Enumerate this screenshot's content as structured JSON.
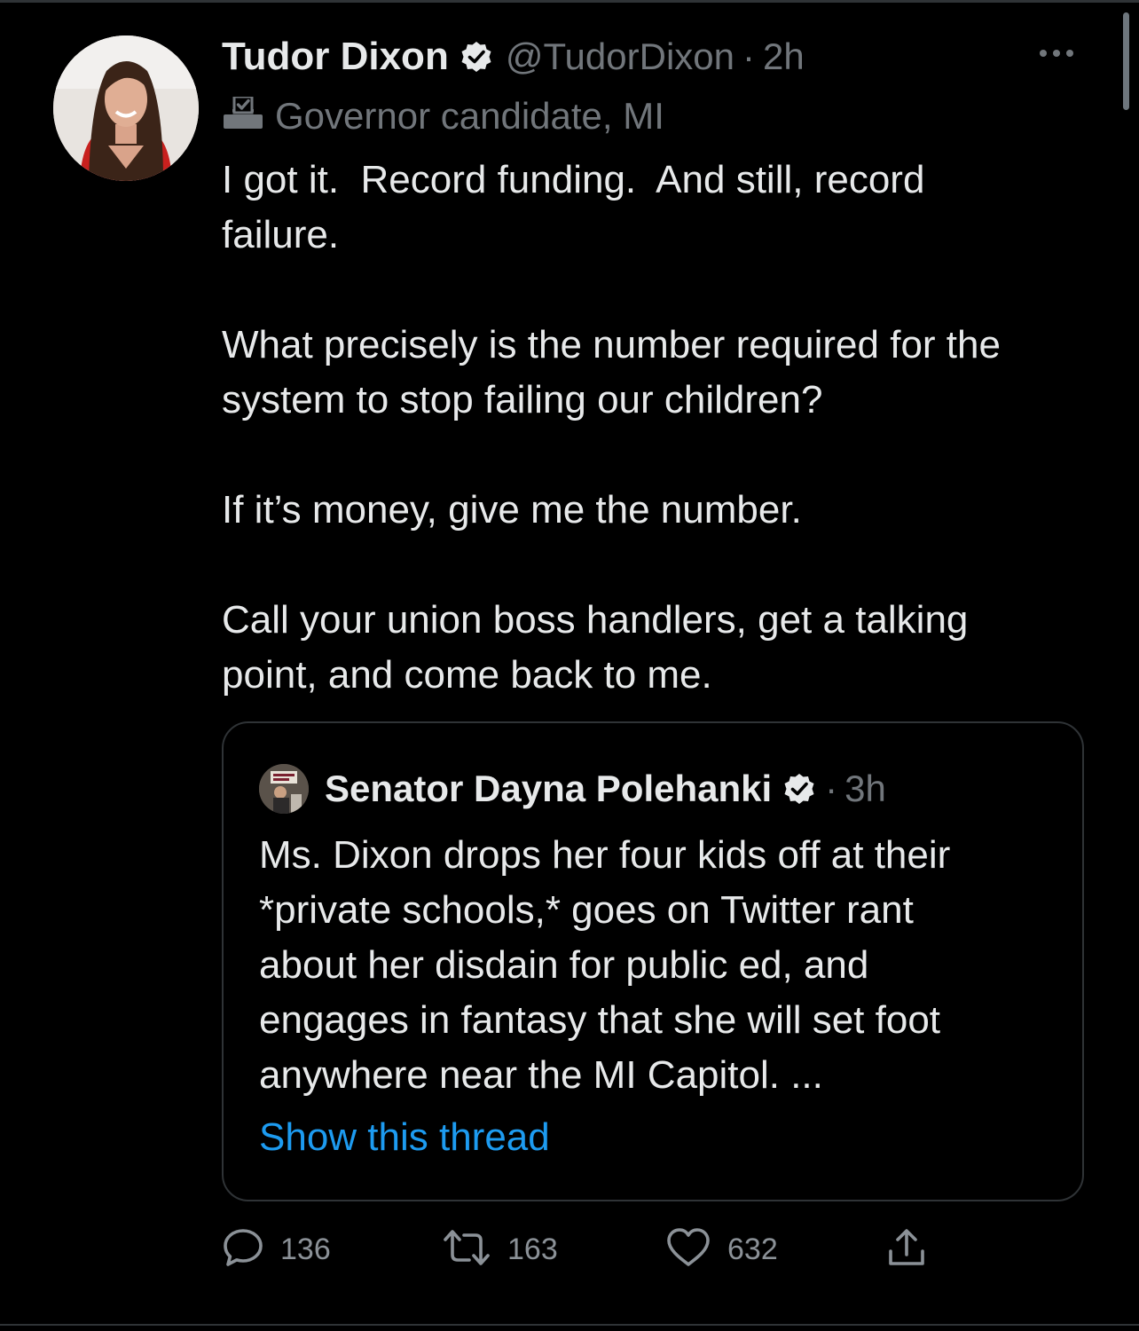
{
  "tweet": {
    "author_name": "Tudor Dixon",
    "handle": "@TudorDixon",
    "separator": "·",
    "time": "2h",
    "label": "Governor candidate, MI",
    "label_icon": "ballot-box-icon",
    "text": "I got it.  Record funding.  And still, record\nfailure.\n\nWhat precisely is the number required for the\nsystem to stop failing our children?\n\nIf it’s money, give me the number.\n\nCall your union boss handlers, get a talking\npoint, and come back to me."
  },
  "quoted_tweet": {
    "author_name": "Senator Dayna Polehanki",
    "separator": "·",
    "time": "3h",
    "text": "Ms. Dixon drops her four kids off at their\n*private schools,* goes on Twitter rant\nabout her disdain for public ed, and\nengages in fantasy that she will set foot\nanywhere near the MI Capitol. ...",
    "show_thread": "Show this thread"
  },
  "actions": {
    "replies": "136",
    "retweets": "163",
    "likes": "632"
  },
  "colors": {
    "background": "#000000",
    "text": "#e7e9ea",
    "secondary": "#71767b",
    "link": "#1d9bf0",
    "border": "#2f3336"
  }
}
